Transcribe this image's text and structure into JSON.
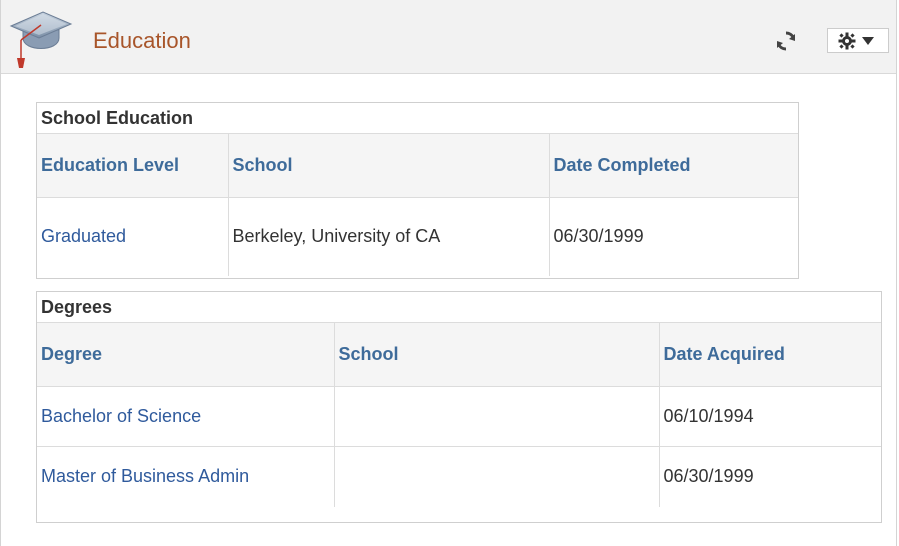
{
  "header": {
    "title": "Education",
    "icon": "graduation-cap-icon",
    "refresh_icon": "refresh-icon",
    "settings_icon": "gear-icon",
    "accent_color": "#a8552a"
  },
  "school_education": {
    "caption": "School Education",
    "columns": [
      "Education Level",
      "School",
      "Date Completed"
    ],
    "rows": [
      {
        "level": "Graduated",
        "school": "Berkeley, University of CA",
        "date": "06/30/1999"
      }
    ]
  },
  "degrees": {
    "caption": "Degrees",
    "columns": [
      "Degree",
      "School",
      "Date Acquired"
    ],
    "rows": [
      {
        "degree": "Bachelor of Science",
        "school": "",
        "date": "06/10/1994"
      },
      {
        "degree": "Master of Business Admin",
        "school": "",
        "date": "06/30/1999"
      }
    ]
  },
  "colors": {
    "link": "#2f5a9c",
    "header_text": "#3e6b9a",
    "header_bg": "#f2f2f2"
  }
}
